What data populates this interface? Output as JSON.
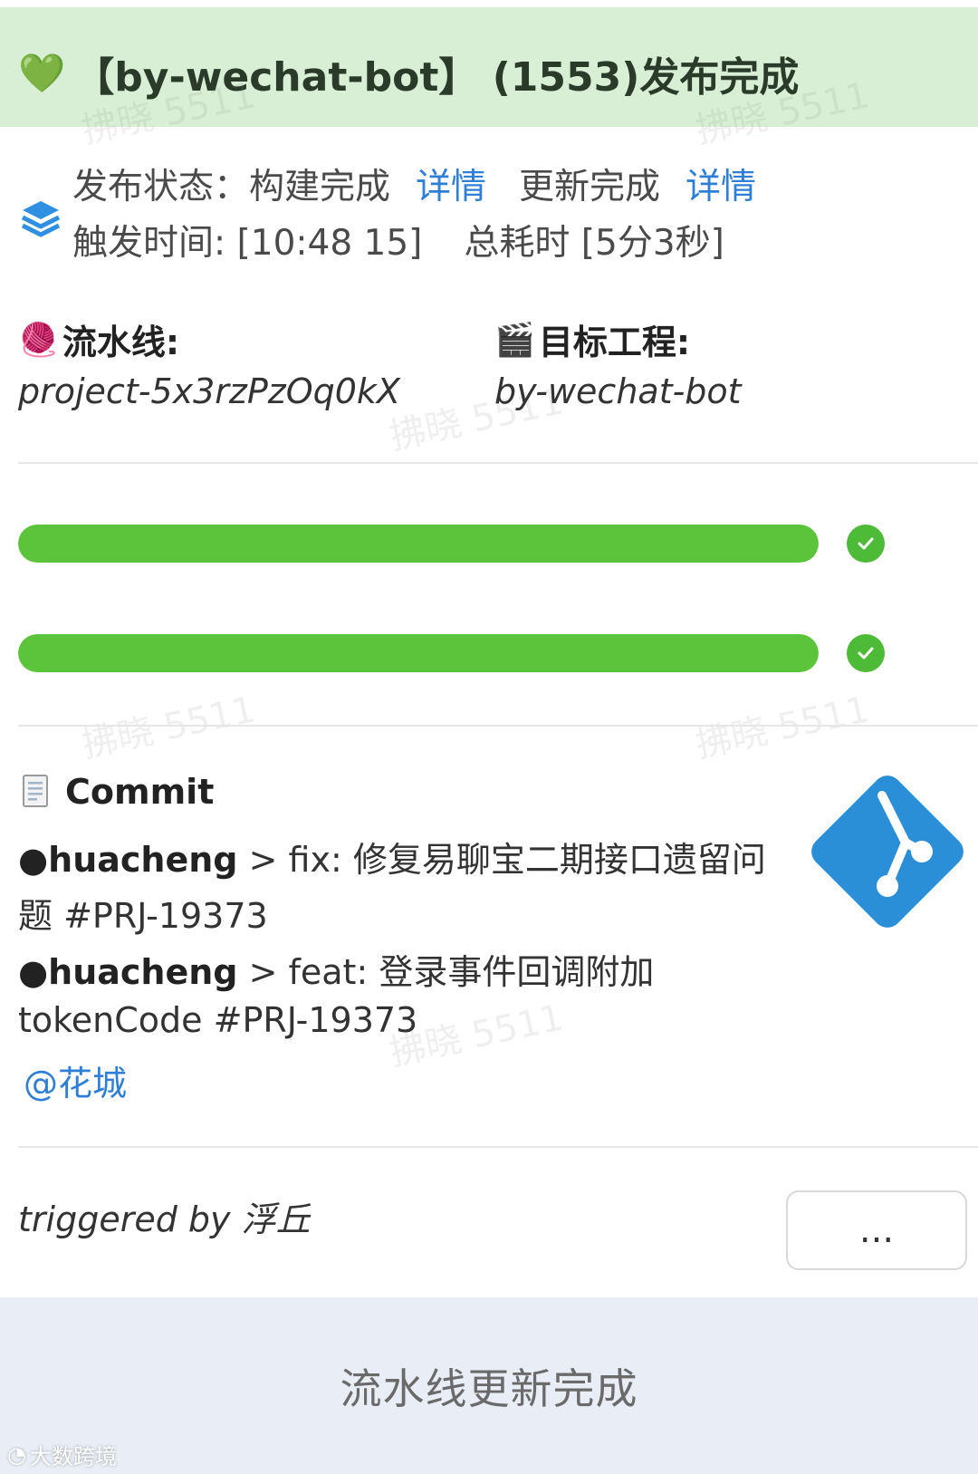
{
  "header": {
    "emoji": "💚",
    "title": "【by-wechat-bot】 (1553)发布完成"
  },
  "watermark": "拂晓 5511",
  "status": {
    "publish_label": "发布状态：构建完成",
    "publish_link": "详情",
    "update_label": "更新完成",
    "update_link": "详情",
    "trigger_time_label": "触发时间: [10:48 15]",
    "duration_label": "总耗时 [5分3秒]"
  },
  "pipeline": {
    "emoji": "🧶",
    "label": "流水线:",
    "value": "project-5x3rzPzOq0kX"
  },
  "target": {
    "emoji": "🎬",
    "label": "目标工程:",
    "value": "by-wechat-bot"
  },
  "progress": [
    {
      "value": 1.0,
      "status": "done"
    },
    {
      "value": 1.0,
      "status": "done"
    }
  ],
  "commit": {
    "title": "Commit",
    "entries": [
      {
        "author": "●huacheng",
        "message_line1": " > fix: 修复易聊宝二期接口遗留问",
        "message_line2": "题 #PRJ-19373"
      },
      {
        "author": "●huacheng",
        "message_line1": " > feat: 登录事件回调附加",
        "message_line2": "tokenCode #PRJ-19373"
      }
    ],
    "mention": "@花城"
  },
  "trigger": {
    "text": "triggered by 浮丘",
    "more_label": "..."
  },
  "footer": {
    "button_label": "流水线更新完成"
  },
  "brand": "大数跨境",
  "colors": {
    "header_bg": "#d9efd5",
    "progress": "#5bc43a",
    "link": "#2f7fd6",
    "git": "#2b8fd8",
    "footer_bg": "#e9edf6"
  }
}
